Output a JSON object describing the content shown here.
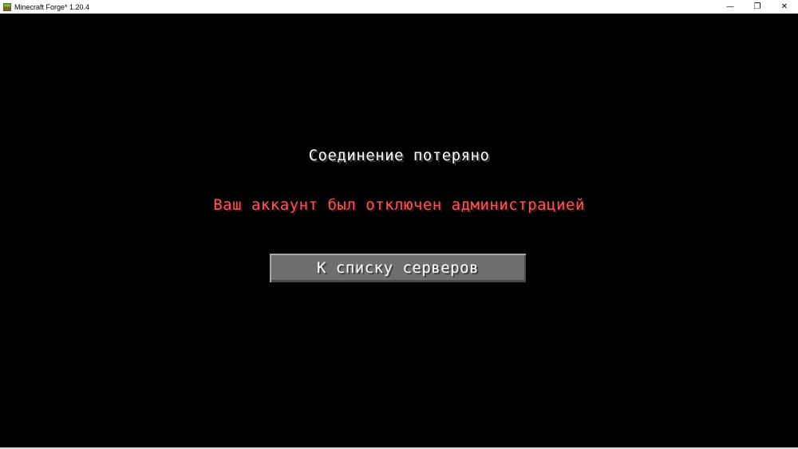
{
  "window": {
    "title": "Minecraft Forge* 1.20.4",
    "controls": {
      "minimize": "—",
      "maximize": "❐",
      "close": "✕"
    }
  },
  "screen": {
    "title": "Соединение потеряно",
    "reason": "Ваш аккаунт был отключен администрацией",
    "reason_color": "#ff5555",
    "button_label": "К списку серверов"
  },
  "icons": {
    "app": "minecraft-grass-block-icon"
  }
}
